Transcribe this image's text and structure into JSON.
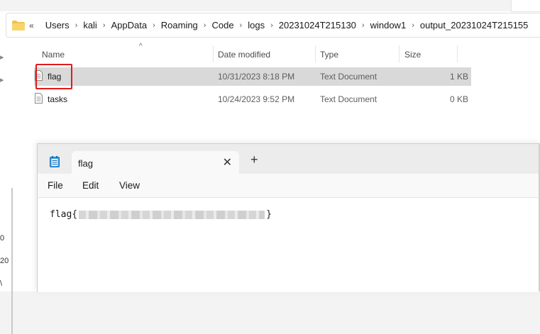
{
  "address_bar": {
    "overflow_glyph": "«",
    "crumbs": [
      "Users",
      "kali",
      "AppData",
      "Roaming",
      "Code",
      "logs",
      "20231024T215130",
      "window1",
      "output_20231024T215155"
    ]
  },
  "file_list": {
    "columns": {
      "name": "Name",
      "date": "Date modified",
      "type": "Type",
      "size": "Size"
    },
    "rows": [
      {
        "name": "flag",
        "date": "10/31/2023 8:18 PM",
        "type": "Text Document",
        "size": "1 KB",
        "selected": true
      },
      {
        "name": "tasks",
        "date": "10/24/2023 9:52 PM",
        "type": "Text Document",
        "size": "0 KB",
        "selected": false
      }
    ]
  },
  "left_pane_glyphs": [
    "0",
    "20",
    "\\"
  ],
  "notepad": {
    "tab_title": "flag",
    "close_glyph": "✕",
    "add_glyph": "+",
    "menu": {
      "file": "File",
      "edit": "Edit",
      "view": "View"
    },
    "content_prefix": "flag{",
    "content_suffix": "}"
  },
  "colors": {
    "highlight": "#e01b1b",
    "selected_row": "#d9d9d9",
    "folder": "#f2c24b"
  },
  "icons": [
    "folder-icon",
    "text-document-icon",
    "notepad-icon",
    "close-icon",
    "add-tab-icon"
  ]
}
